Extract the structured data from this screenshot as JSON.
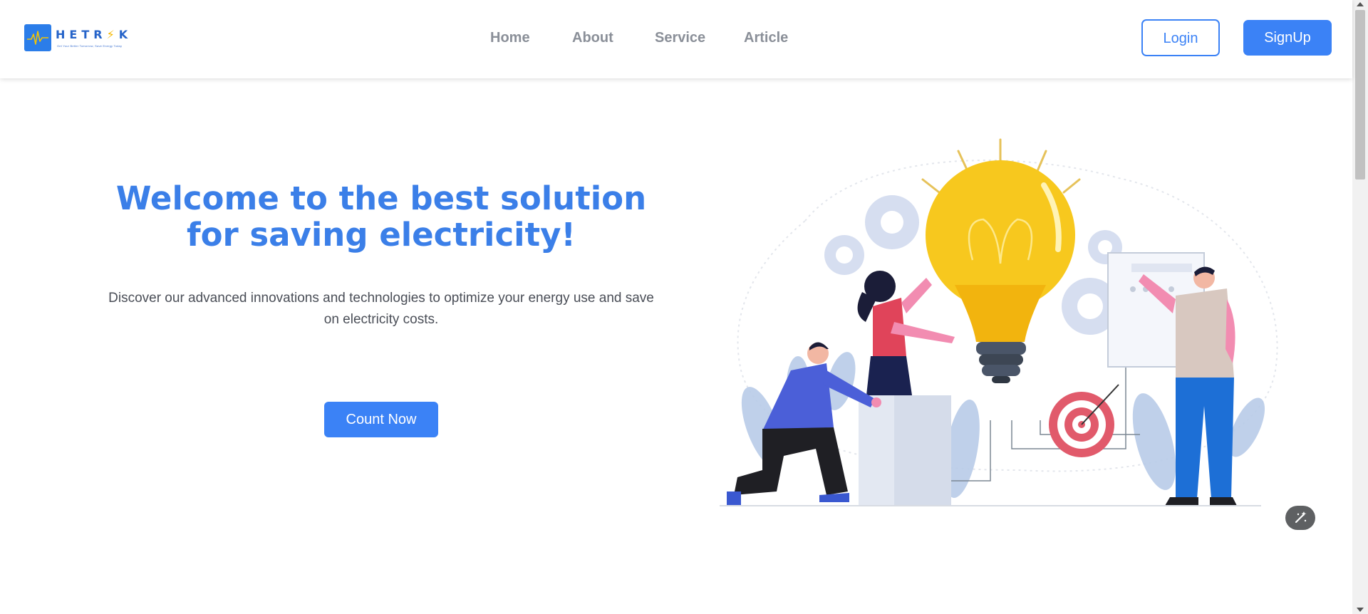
{
  "brand": {
    "name_part1": "HETR",
    "bolt_glyph": "⚡",
    "name_part2": "K",
    "tagline": "Get Your Better Tomorrow, Save Energy Today",
    "logo_icon": "heartbeat-pulse-icon",
    "color": "#2b7de9"
  },
  "nav": {
    "items": [
      {
        "label": "Home"
      },
      {
        "label": "About"
      },
      {
        "label": "Service"
      },
      {
        "label": "Article"
      }
    ],
    "login_label": "Login",
    "signup_label": "SignUp"
  },
  "hero": {
    "title": "Welcome to the best solution for saving electricity!",
    "description": "Discover our advanced innovations and technologies to optimize your energy use and save on electricity costs.",
    "cta_label": "Count Now",
    "illustration": "lightbulb-teamwork-illustration"
  },
  "floating_button": {
    "icon": "magic-wand-icon"
  },
  "colors": {
    "accent": "#3b82f6",
    "title": "#3b7fe8",
    "nav_text": "#8a8f98",
    "body_text": "#4a4e57"
  }
}
